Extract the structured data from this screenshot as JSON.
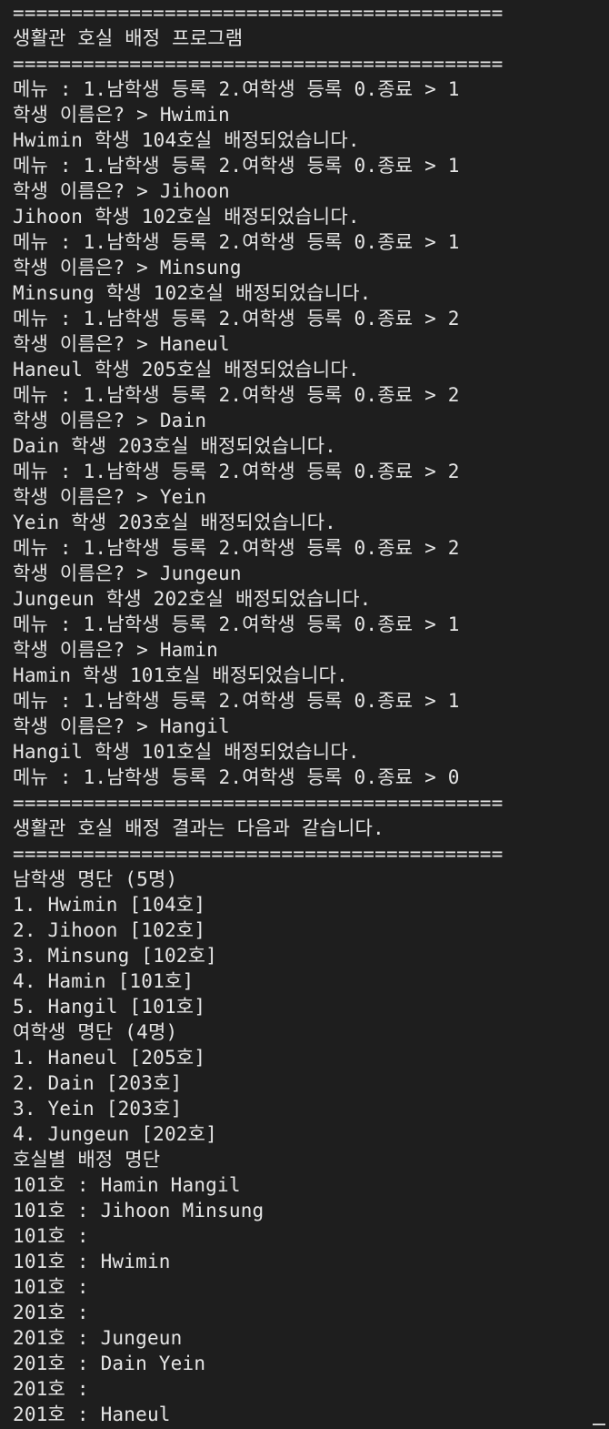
{
  "terminal": {
    "lines": [
      "==========================================",
      "생활관 호실 배정 프로그램",
      "==========================================",
      "메뉴 : 1.남학생 등록 2.여학생 등록 0.종료 > 1",
      "학생 이름은? > Hwimin",
      "Hwimin 학생 104호실 배정되었습니다.",
      "메뉴 : 1.남학생 등록 2.여학생 등록 0.종료 > 1",
      "학생 이름은? > Jihoon",
      "Jihoon 학생 102호실 배정되었습니다.",
      "메뉴 : 1.남학생 등록 2.여학생 등록 0.종료 > 1",
      "학생 이름은? > Minsung",
      "Minsung 학생 102호실 배정되었습니다.",
      "메뉴 : 1.남학생 등록 2.여학생 등록 0.종료 > 2",
      "학생 이름은? > Haneul",
      "Haneul 학생 205호실 배정되었습니다.",
      "메뉴 : 1.남학생 등록 2.여학생 등록 0.종료 > 2",
      "학생 이름은? > Dain",
      "Dain 학생 203호실 배정되었습니다.",
      "메뉴 : 1.남학생 등록 2.여학생 등록 0.종료 > 2",
      "학생 이름은? > Yein",
      "Yein 학생 203호실 배정되었습니다.",
      "메뉴 : 1.남학생 등록 2.여학생 등록 0.종료 > 2",
      "학생 이름은? > Jungeun",
      "Jungeun 학생 202호실 배정되었습니다.",
      "메뉴 : 1.남학생 등록 2.여학생 등록 0.종료 > 1",
      "학생 이름은? > Hamin",
      "Hamin 학생 101호실 배정되었습니다.",
      "메뉴 : 1.남학생 등록 2.여학생 등록 0.종료 > 1",
      "학생 이름은? > Hangil",
      "Hangil 학생 101호실 배정되었습니다.",
      "메뉴 : 1.남학생 등록 2.여학생 등록 0.종료 > 0",
      "==========================================",
      "생활관 호실 배정 결과는 다음과 같습니다.",
      "==========================================",
      "남학생 명단 (5명)",
      "1. Hwimin [104호]",
      "2. Jihoon [102호]",
      "3. Minsung [102호]",
      "4. Hamin [101호]",
      "5. Hangil [101호]",
      "여학생 명단 (4명)",
      "1. Haneul [205호]",
      "2. Dain [203호]",
      "3. Yein [203호]",
      "4. Jungeun [202호]",
      "호실별 배정 명단",
      "101호 : Hamin Hangil",
      "101호 : Jihoon Minsung",
      "101호 :",
      "101호 : Hwimin",
      "101호 :",
      "201호 :",
      "201호 : Jungeun",
      "201호 : Dain Yein",
      "201호 :",
      "201호 : Haneul"
    ]
  }
}
